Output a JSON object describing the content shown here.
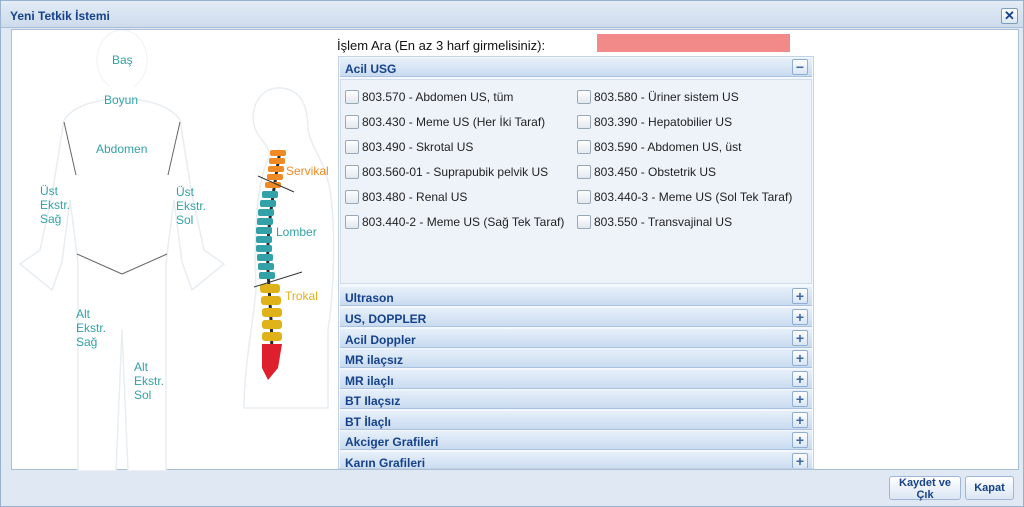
{
  "window": {
    "title": "Yeni Tetkik İstemi",
    "close_symbol": "✕"
  },
  "body_regions": {
    "bas": "Baş",
    "boyun": "Boyun",
    "abdomen": "Abdomen",
    "ust_ekstr_sag": [
      "Üst",
      "Ekstr.",
      "Sağ"
    ],
    "ust_ekstr_sol": [
      "Üst",
      "Ekstr.",
      "Sol"
    ],
    "alt_ekstr_sag": [
      "Alt",
      "Ekstr.",
      "Sağ"
    ],
    "alt_ekstr_sol": [
      "Alt",
      "Ekstr.",
      "Sol"
    ]
  },
  "spine_labels": {
    "servikal": "Servikal",
    "lomber": "Lomber",
    "trokal": "Trokal"
  },
  "colors": {
    "region_text": "#33a1a8",
    "servikal": "#f08a24",
    "lomber": "#33a1a8",
    "trokal": "#e0b21a",
    "sacrum": "#e01f2d",
    "search_bg": "#f38a8a",
    "accordion_header_text": "#15428b"
  },
  "search": {
    "label": "İşlem Ara (En az 3 harf girmelisiniz):",
    "value": ""
  },
  "accordion": {
    "expanded": {
      "title": "Acil USG",
      "toggle": "−",
      "left_items": [
        "803.570 - Abdomen US, tüm",
        "803.430 - Meme US (Her İki Taraf)",
        "803.490 - Skrotal US",
        "803.560-01 - Suprapubik pelvik US",
        "803.480 - Renal US",
        "803.440-2 - Meme US (Sağ Tek Taraf)"
      ],
      "right_items": [
        "803.580 - Üriner sistem US",
        "803.390 - Hepatobilier US",
        "803.590 - Abdomen US, üst",
        "803.450 - Obstetrik US",
        "803.440-3 - Meme US (Sol Tek Taraf)",
        "803.550 - Transvajinal US"
      ]
    },
    "collapsed_toggle": "+",
    "collapsed": [
      "Ultrason",
      "US, DOPPLER",
      "Acil Doppler",
      "MR ilaçsız",
      "MR ilaçlı",
      "BT Ilaçsız",
      "BT İlaçlı",
      "Akciger Grafileri",
      "Karın Grafileri"
    ]
  },
  "footer": {
    "save_label": "Kaydet ve Çık",
    "close_label": "Kapat"
  }
}
